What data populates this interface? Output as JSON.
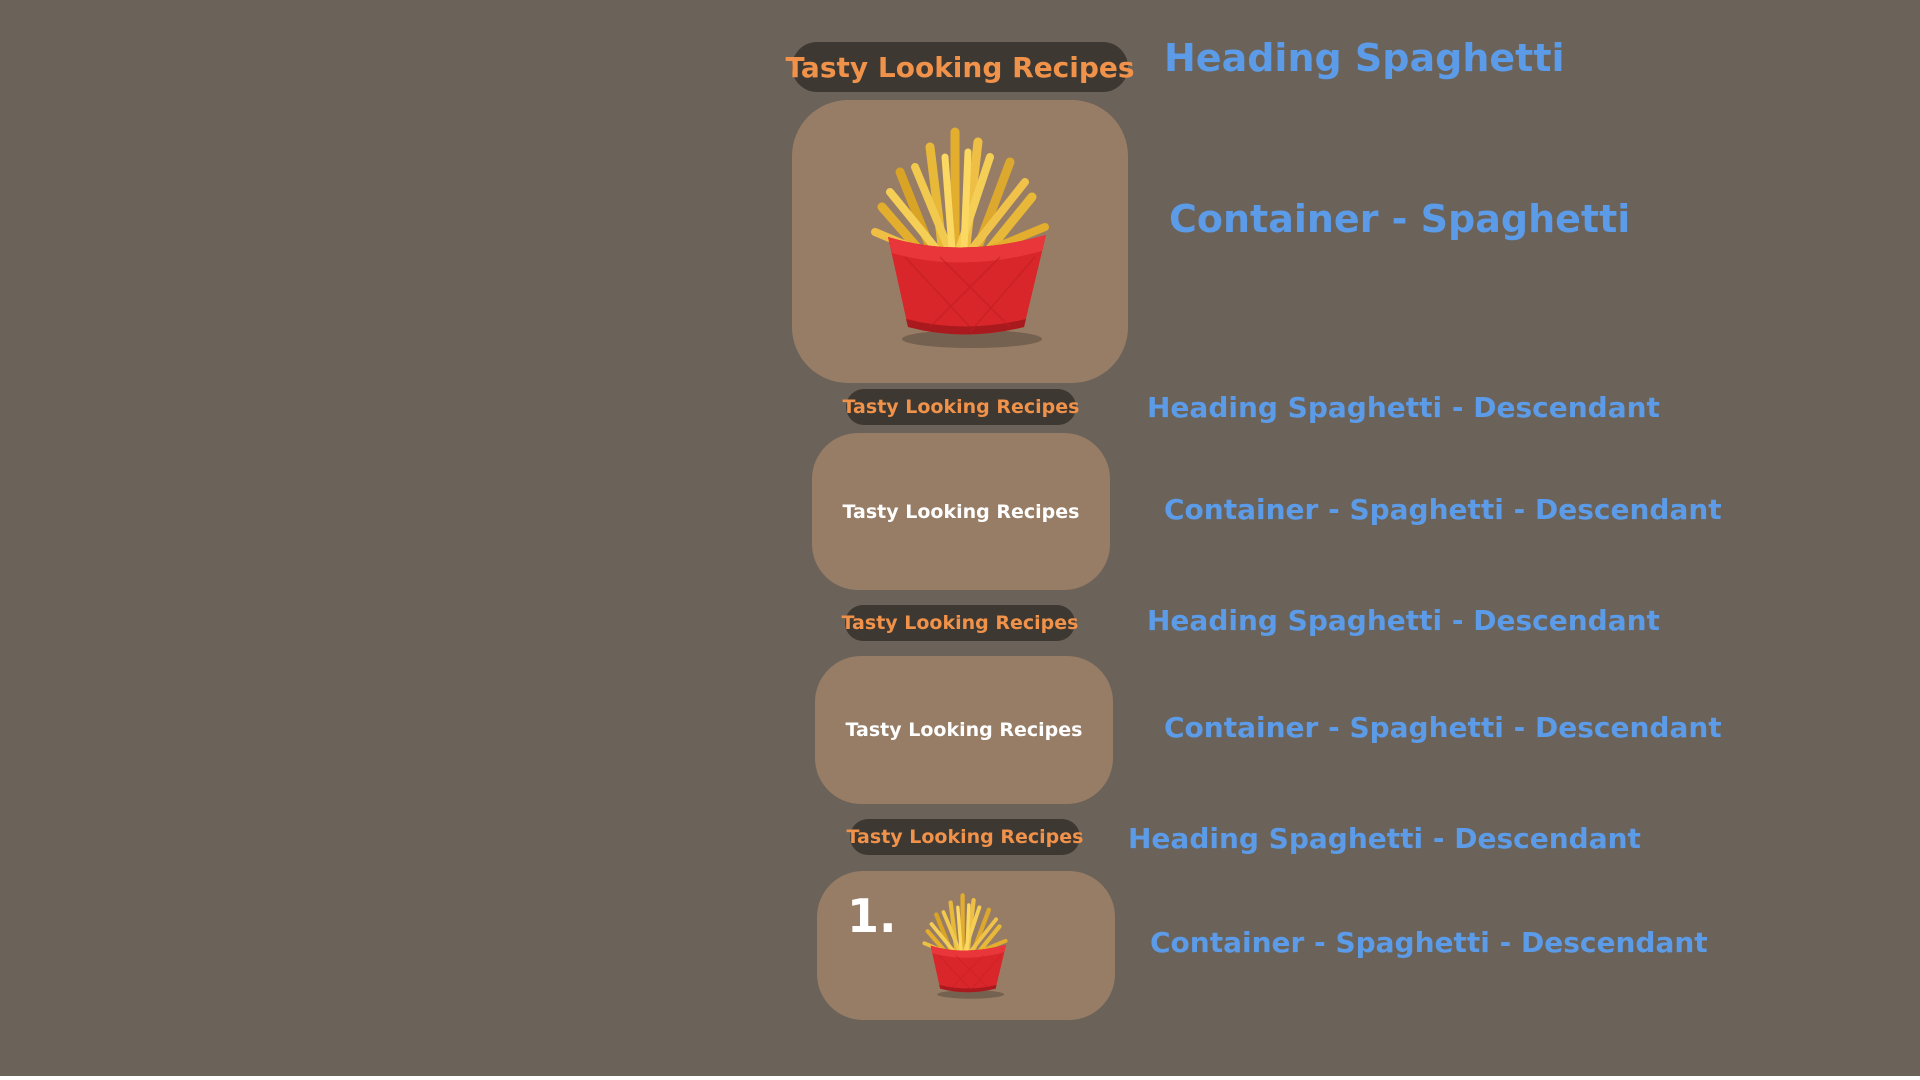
{
  "colors": {
    "background": "#6b6259",
    "pill_background": "#3e3832",
    "pill_text": "#f0924a",
    "card_background": "#987d66",
    "label_text": "#5b9be8",
    "card_text": "#ffffff"
  },
  "stack": {
    "main_heading": "Tasty Looking Recipes",
    "main_container": {
      "image": "fries-icon"
    },
    "sub_heading_1": "Tasty Looking Recipes",
    "sub_container_1": {
      "text": "Tasty Looking Recipes"
    },
    "sub_heading_2": "Tasty Looking Recipes",
    "sub_container_2": {
      "text": "Tasty Looking Recipes"
    },
    "sub_heading_3": "Tasty Looking Recipes",
    "sub_container_3": {
      "number": "1.",
      "image": "fries-icon"
    }
  },
  "annotations": {
    "heading": "Heading Spaghetti",
    "container": "Container - Spaghetti",
    "heading_descendant_1": "Heading Spaghetti - Descendant",
    "container_descendant_1": "Container - Spaghetti - Descendant",
    "heading_descendant_2": "Heading Spaghetti - Descendant",
    "container_descendant_2": "Container - Spaghetti - Descendant",
    "heading_descendant_3": "Heading Spaghetti - Descendant",
    "container_descendant_3": "Container - Spaghetti - Descendant"
  }
}
